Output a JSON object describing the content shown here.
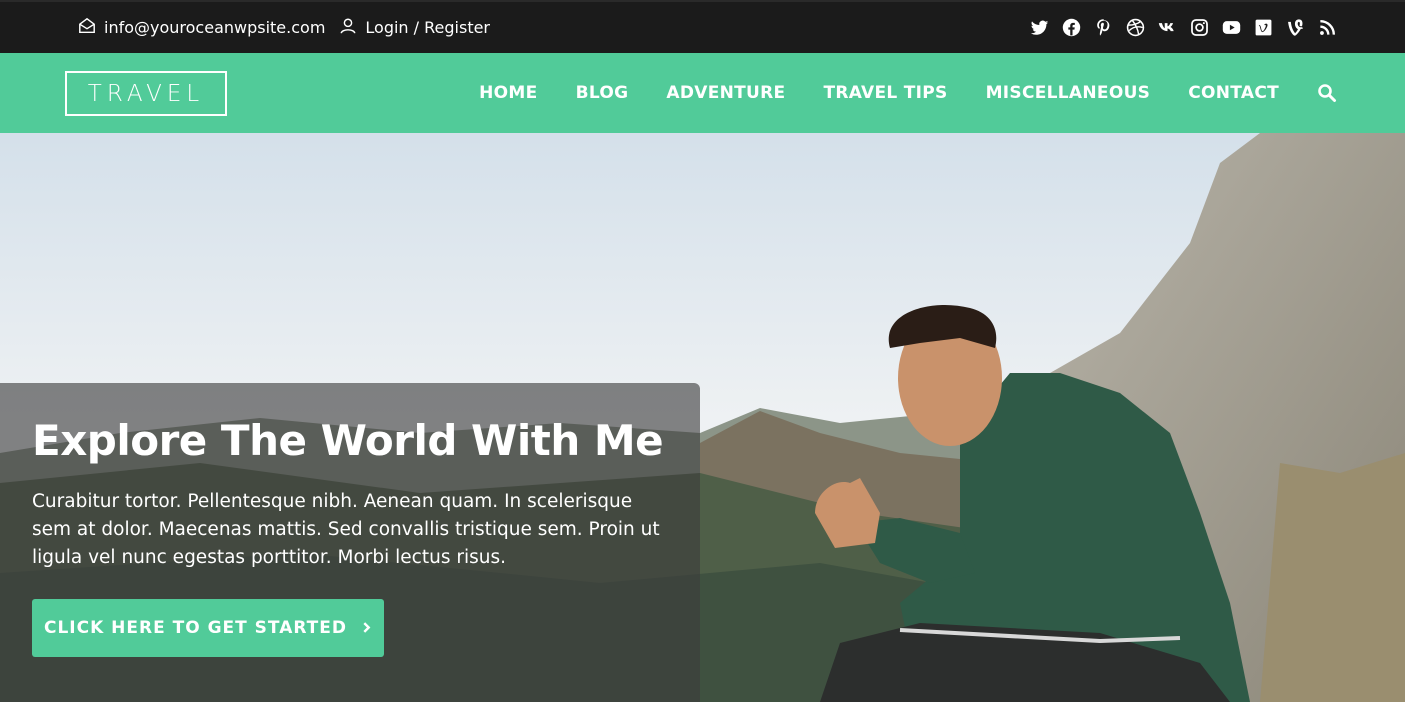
{
  "topbar": {
    "email": "info@youroceanwpsite.com",
    "login_register": "Login / Register",
    "social_icons": [
      "twitter-icon",
      "facebook-icon",
      "pinterest-icon",
      "dribbble-icon",
      "vk-icon",
      "instagram-icon",
      "youtube-icon",
      "vimeo-square-icon",
      "vine-icon",
      "rss-icon"
    ]
  },
  "header": {
    "logo": "TRAVEL",
    "nav": [
      "HOME",
      "BLOG",
      "ADVENTURE",
      "TRAVEL TIPS",
      "MISCELLANEOUS",
      "CONTACT"
    ]
  },
  "hero": {
    "title": "Explore The World With Me",
    "text": "Curabitur tortor. Pellentesque nibh. Aenean quam. In scelerisque sem at dolor. Maecenas mattis. Sed convallis tristique sem. Proin ut ligula vel nunc egestas porttitor. Morbi lectus risus.",
    "cta": "CLICK HERE TO GET STARTED"
  },
  "colors": {
    "accent": "#51cb99",
    "topbar_bg": "#1b1b1b"
  }
}
